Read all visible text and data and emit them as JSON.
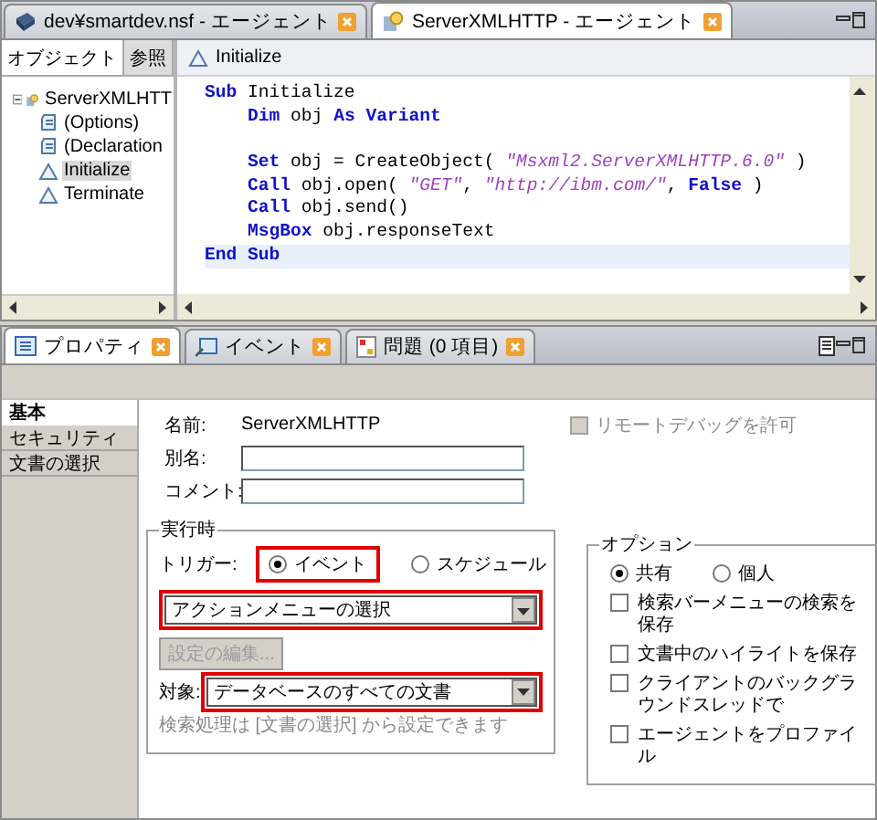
{
  "editor_tabs": [
    {
      "label": "dev¥smartdev.nsf - エージェント",
      "selected": false,
      "kind": "database"
    },
    {
      "label": "ServerXMLHTTP - エージェント",
      "selected": true,
      "kind": "agent"
    }
  ],
  "object_panel": {
    "tabs": [
      {
        "label": "オブジェクト",
        "selected": true
      },
      {
        "label": "参照",
        "selected": false
      }
    ],
    "tree": [
      {
        "label": "ServerXMLHTT",
        "kind": "agent",
        "selected": false,
        "expanded": true,
        "children": [
          {
            "label": "(Options)",
            "kind": "script",
            "selected": false
          },
          {
            "label": "(Declaration",
            "kind": "script",
            "selected": false
          },
          {
            "label": "Initialize",
            "kind": "event",
            "selected": true
          },
          {
            "label": "Terminate",
            "kind": "event",
            "selected": false
          }
        ]
      }
    ]
  },
  "editor": {
    "header": "Initialize",
    "lines": [
      {
        "current": false,
        "tokens": [
          {
            "kind": "keyword",
            "text": "Sub"
          },
          {
            "kind": "plain",
            "text": " Initialize"
          }
        ]
      },
      {
        "current": false,
        "indented": true,
        "tokens": [
          {
            "kind": "keyword",
            "text": "Dim"
          },
          {
            "kind": "plain",
            "text": " obj "
          },
          {
            "kind": "keyword",
            "text": "As Variant"
          }
        ]
      },
      {
        "current": false
      },
      {
        "current": false,
        "indented": true,
        "tokens": [
          {
            "kind": "keyword",
            "text": "Set"
          },
          {
            "kind": "plain",
            "text": " obj = CreateObject( "
          },
          {
            "kind": "string",
            "text": "\"Msxml2.ServerXMLHTTP.6.0\""
          },
          {
            "kind": "plain",
            "text": " )"
          }
        ]
      },
      {
        "current": false,
        "indented": true,
        "tokens": [
          {
            "kind": "keyword",
            "text": "Call"
          },
          {
            "kind": "plain",
            "text": " obj.open( "
          },
          {
            "kind": "string",
            "text": "\"GET\""
          },
          {
            "kind": "plain",
            "text": ", "
          },
          {
            "kind": "string",
            "text": "\"http://ibm.com/\""
          },
          {
            "kind": "plain",
            "text": ", "
          },
          {
            "kind": "keyword",
            "text": "False"
          },
          {
            "kind": "plain",
            "text": " )"
          }
        ]
      },
      {
        "current": false,
        "indented": true,
        "tokens": [
          {
            "kind": "keyword",
            "text": "Call"
          },
          {
            "kind": "plain",
            "text": " obj.send()"
          }
        ]
      },
      {
        "current": false,
        "indented": true,
        "tokens": [
          {
            "kind": "keyword",
            "text": "MsgBox"
          },
          {
            "kind": "plain",
            "text": " obj.responseText"
          }
        ]
      },
      {
        "current": true,
        "tokens": [
          {
            "kind": "keyword",
            "text": "End Sub"
          }
        ]
      }
    ]
  },
  "view_tabs": [
    {
      "label": "プロパティ",
      "selected": true,
      "kind": "properties"
    },
    {
      "label": "イベント",
      "selected": false,
      "kind": "events"
    },
    {
      "label": "問題 (0 項目)",
      "selected": false,
      "kind": "problems"
    }
  ],
  "sidebar": {
    "items": [
      {
        "label": "基本",
        "selected": true
      },
      {
        "label": "セキュリティ",
        "selected": false
      },
      {
        "label": "文書の選択",
        "selected": false
      }
    ]
  },
  "properties": {
    "name": {
      "label": "名前:",
      "value": "ServerXMLHTTP"
    },
    "remote_debug": {
      "label": "リモートデバッグを許可",
      "checked": false,
      "disabled": true
    },
    "alias": {
      "label": "別名:"
    },
    "comment": {
      "label": "コメント:"
    },
    "runtime": {
      "title": "実行時",
      "trigger_label": "トリガー:",
      "trigger_options": [
        {
          "label": "イベント",
          "selected": true,
          "highlighted": true
        },
        {
          "label": "スケジュール",
          "selected": false,
          "highlighted": false
        }
      ],
      "event_dropdown": {
        "value": "アクションメニューの選択",
        "highlighted": true
      },
      "edit_button": {
        "label": "設定の編集...",
        "disabled": true
      },
      "target_label": "対象:",
      "target_dropdown": {
        "value": "データベースのすべての文書",
        "highlighted": true
      },
      "note": "検索処理は [文書の選択] から設定できます"
    },
    "options": {
      "title": "オプション",
      "scope": [
        {
          "label": "共有",
          "selected": true
        },
        {
          "label": "個人",
          "selected": false
        }
      ],
      "checkboxes": [
        {
          "label": "検索バーメニューの検索を保存",
          "checked": false
        },
        {
          "label": "文書中のハイライトを保存",
          "checked": false
        },
        {
          "label": "クライアントのバックグラウンドスレッドで",
          "checked": false
        },
        {
          "label": "エージェントをプロファイル",
          "checked": false
        }
      ]
    }
  }
}
